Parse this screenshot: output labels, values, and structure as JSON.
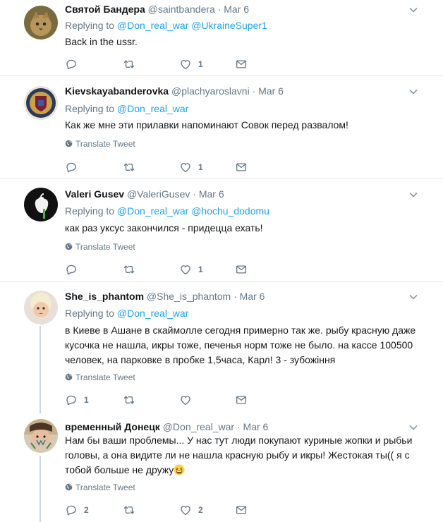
{
  "tweets": [
    {
      "name": "Святой Бандера",
      "handle": "@saintbandera",
      "date": "Mar 6",
      "replying_label": "Replying to",
      "mentions": [
        "@Don_real_war",
        "@UkraineSuper1"
      ],
      "text": "Back in the ussr.",
      "translate": "",
      "reply_count": "",
      "retweet_count": "",
      "like_count": "1"
    },
    {
      "name": "Kievskayabanderovka",
      "handle": "@plachyaroslavni",
      "date": "Mar 6",
      "replying_label": "Replying to",
      "mentions": [
        "@Don_real_war"
      ],
      "text": "Как же мне эти прилавки напоминают Совок перед развалом!",
      "translate": "Translate Tweet",
      "reply_count": "",
      "retweet_count": "",
      "like_count": "1"
    },
    {
      "name": "Valeri Gusev",
      "handle": "@ValeriGusev",
      "date": "Mar 6",
      "replying_label": "Replying to",
      "mentions": [
        "@Don_real_war",
        "@hochu_dodomu"
      ],
      "text": "как раз уксус закончился - придецца ехать!",
      "translate": "Translate Tweet",
      "reply_count": "",
      "retweet_count": "",
      "like_count": "1"
    },
    {
      "name": "She_is_phantom",
      "handle": "@She_is_phantom",
      "date": "Mar 6",
      "replying_label": "Replying to",
      "mentions": [
        "@Don_real_war"
      ],
      "text": "в Киеве в Ашане в скаймолле сегодня примерно так же. рыбу красную даже кусочка не нашла, икры тоже, печенья норм тоже не было. на кассе 100500 человек, на парковке в пробке 1,5часа, Карл! 3 - зубожіння",
      "translate": "Translate Tweet",
      "reply_count": "1",
      "retweet_count": "",
      "like_count": ""
    },
    {
      "name": "временный Донецк",
      "handle": "@Don_real_war",
      "date": "Mar 6",
      "replying_label": "",
      "mentions": [],
      "text": "Нам бы ваши проблемы... У нас тут люди покупают куриные жопки и рыбьи головы, а она видите ли не нашла красную рыбу и икры! Жестокая ты(( я с тобой больше не дружу",
      "translate": "Translate Tweet",
      "reply_count": "2",
      "retweet_count": "",
      "like_count": "2"
    }
  ],
  "colors": {
    "link": "#1da1f2",
    "muted": "#657786",
    "divider": "#e6ecf0",
    "thread": "#ccd6dd"
  },
  "icons": {
    "reply": "speech-bubble-icon",
    "retweet": "retweet-icon",
    "like": "heart-icon",
    "dm": "envelope-icon",
    "translate": "globe-icon",
    "menu": "chevron-down-icon"
  }
}
